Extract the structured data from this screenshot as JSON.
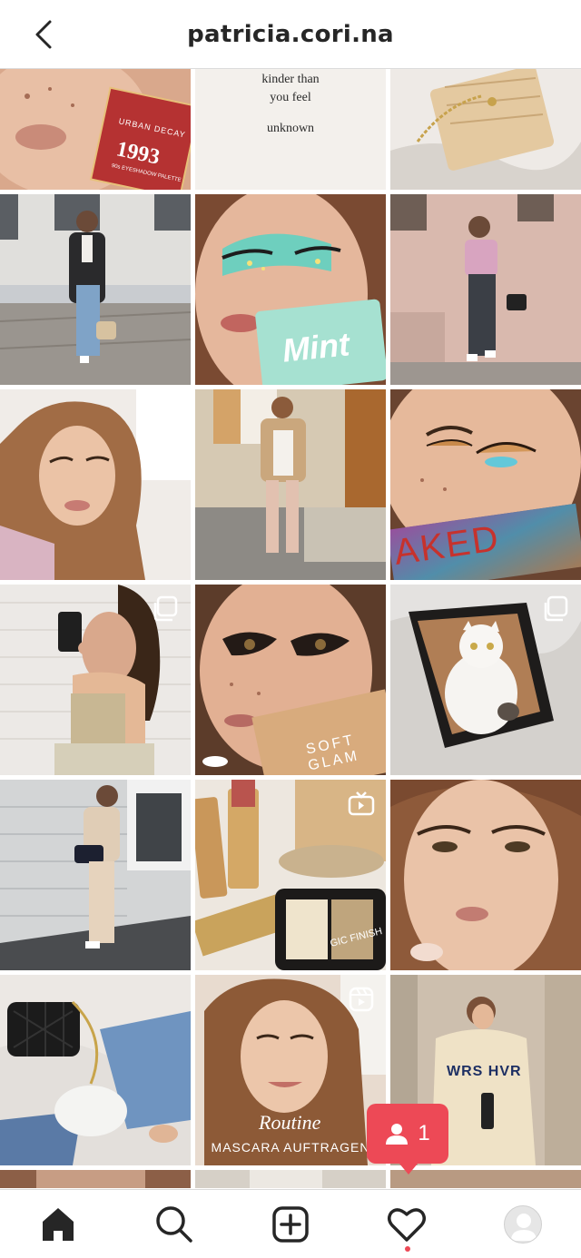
{
  "header": {
    "title": "patricia.cori.na",
    "back_icon": "chevron-left-icon"
  },
  "grid": {
    "quote_post": {
      "line1": "kinder than",
      "line2": "you feel",
      "line3": "unknown"
    },
    "palette_1993": {
      "brand": "URBAN DECAY",
      "name": "1993",
      "sub": "90s EYESHADOW PALETTE"
    },
    "mint_card": {
      "text": "Mint"
    },
    "naked_palette": {
      "text": "AKED"
    },
    "soft_glam": {
      "text": "SOFT GLAM"
    },
    "reel_post": {
      "title": "Routine",
      "subtitle": "MASCARA AUFTRAGEN"
    },
    "compact_text": "GIC FINISH",
    "hoodie_text": "WRS HVR",
    "overlay_icons": {
      "carousel": "carousel-icon",
      "igtv": "igtv-icon",
      "reel": "reel-icon"
    }
  },
  "notification": {
    "count": "1",
    "icon": "person-icon"
  },
  "bottom_nav": {
    "items": [
      "home-icon",
      "search-icon",
      "new-post-icon",
      "activity-heart-icon",
      "profile-avatar"
    ]
  },
  "colors": {
    "accent_red": "#ed4956",
    "text_dark": "#262626",
    "divider": "#dbdbdb"
  }
}
